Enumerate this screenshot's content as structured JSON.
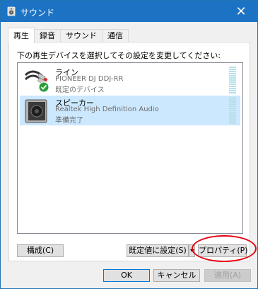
{
  "window": {
    "title": "サウンド",
    "close_glyph": "✕",
    "title_icon": "speaker-window-icon"
  },
  "tabs": [
    {
      "label": "再生",
      "active": true
    },
    {
      "label": "録音",
      "active": false
    },
    {
      "label": "サウンド",
      "active": false
    },
    {
      "label": "通信",
      "active": false
    }
  ],
  "playback": {
    "instruction": "下の再生デバイスを選択してその設定を変更してください:",
    "devices": [
      {
        "name": "ライン",
        "detail": "PIONEER DJ DDJ-RR",
        "status": "既定のデバイス",
        "icon": "line-cable-icon",
        "badge": "default-check-icon",
        "selected": false
      },
      {
        "name": "スピーカー",
        "detail": "Realtek High Definition Audio",
        "status": "準備完了",
        "icon": "speaker-icon",
        "selected": true
      }
    ]
  },
  "buttons": {
    "configure": "構成(C)",
    "set_default": "既定値に設定(S)",
    "properties": "プロパティ(P)",
    "ok": "OK",
    "cancel": "キャンセル",
    "apply": "適用(A)"
  },
  "colors": {
    "titlebar": "#1c73c4",
    "selection": "#cce8ff",
    "annotation": "#e60012",
    "check_badge": "#2a9d3b"
  }
}
